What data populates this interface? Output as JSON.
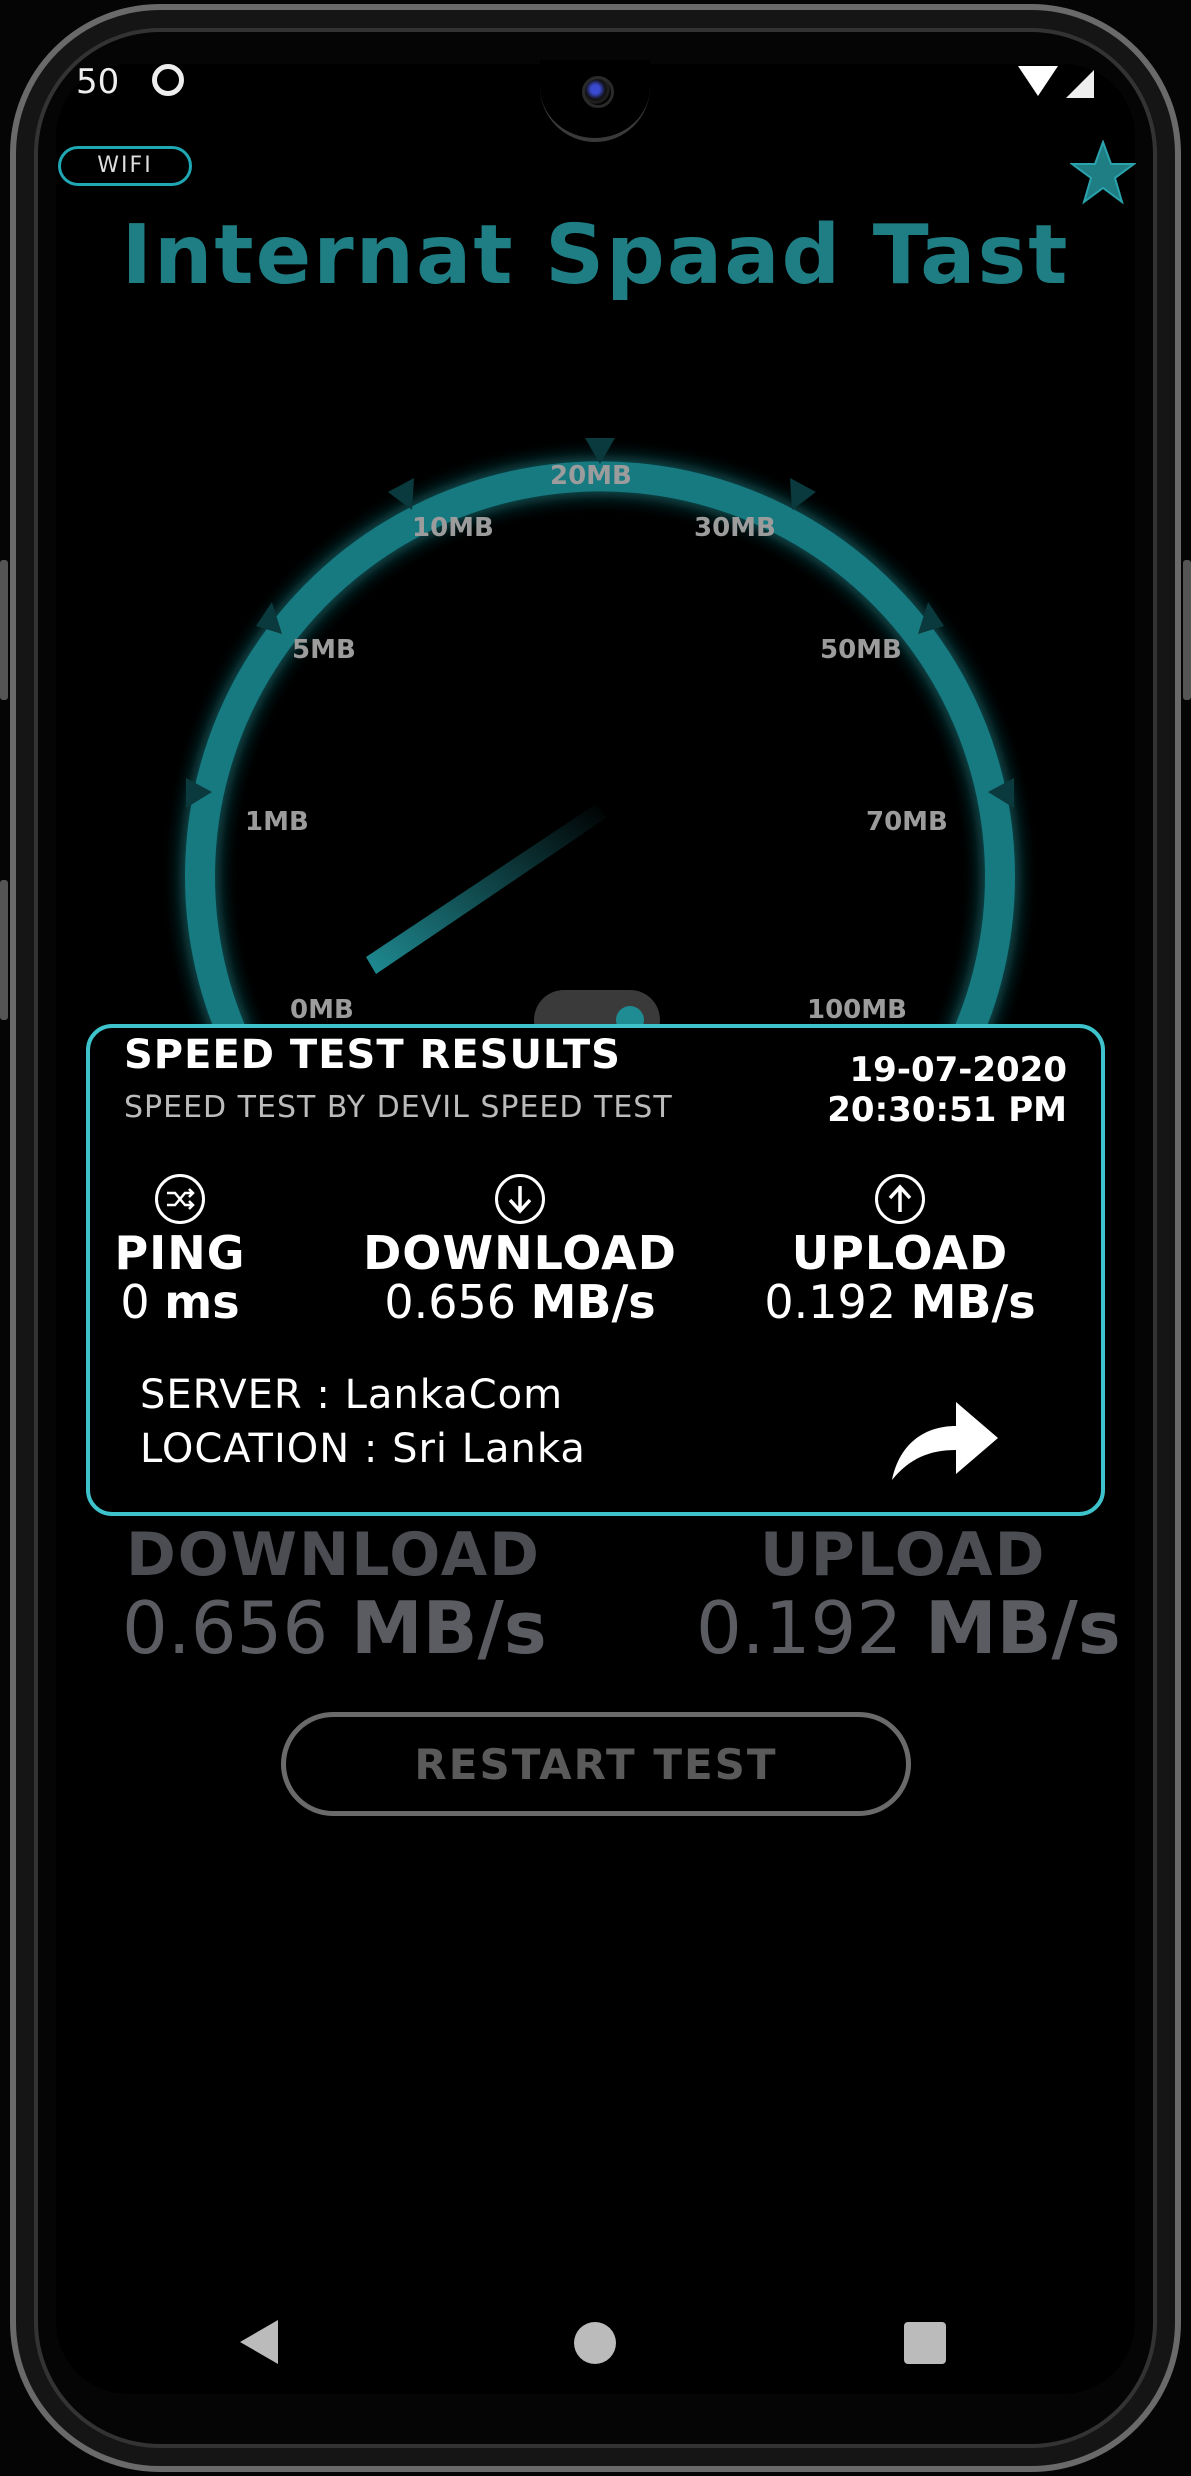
{
  "status_bar": {
    "time_fragment": "50"
  },
  "header": {
    "network_chip": "WIFI",
    "title": "Internat Spaad Tast"
  },
  "gauge": {
    "tick_labels": [
      "0MB",
      "1MB",
      "5MB",
      "10MB",
      "20MB",
      "30MB",
      "50MB",
      "70MB",
      "100MB"
    ],
    "needle_value_mb": 0.656
  },
  "result_card": {
    "title": "SPEED TEST RESULTS",
    "subtitle": "SPEED TEST BY DEVIL SPEED TEST",
    "date": "19-07-2020",
    "time": "20:30:51 PM",
    "ping": {
      "label": "PING",
      "value": "0",
      "unit": "ms",
      "icon": "shuffle-icon"
    },
    "download": {
      "label": "DOWNLOAD",
      "value": "0.656",
      "unit": "MB/s",
      "icon": "arrow-down-circle-icon"
    },
    "upload": {
      "label": "UPLOAD",
      "value": "0.192",
      "unit": "MB/s",
      "icon": "arrow-up-circle-icon"
    },
    "server_line": "SERVER : LankaCom",
    "location_line": "LOCATION : Sri Lanka"
  },
  "summary": {
    "download_label": "DOWNLOAD",
    "download_value": "0.656",
    "download_unit": "MB/s",
    "upload_label": "UPLOAD",
    "upload_value": "0.192",
    "upload_unit": "MB/s"
  },
  "restart_button": "RESTART TEST",
  "colors": {
    "accent": "#3ec3cc",
    "title": "#1f7d84",
    "gauge": "#177a80"
  }
}
